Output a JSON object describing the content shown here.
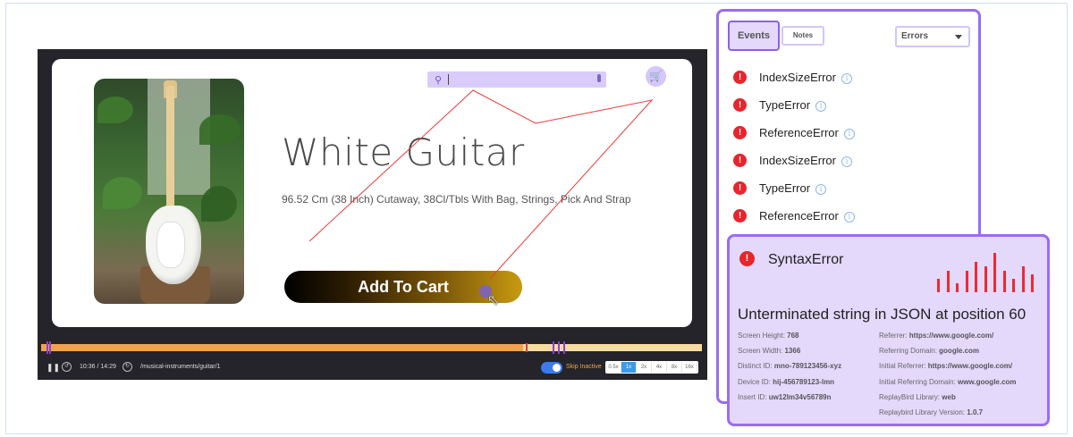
{
  "product": {
    "title": "White Guitar",
    "description": "96.52 Cm (38 Inch) Cutaway, 38Cl/Tbls With Bag, Strings, Pick And Strap",
    "add_to_cart": "Add To Cart",
    "photo_icon": "guitar-photo"
  },
  "header": {
    "search_icon": "search-icon",
    "mic_icon": "mic-icon",
    "cart_icon": "cart-icon"
  },
  "player": {
    "time": "10:36 / 14:29",
    "url": "/musical-instruments/guitar/1",
    "skip_inactive": "Skip Inactive",
    "speeds": [
      "0.5x",
      "1x",
      "2x",
      "4x",
      "8x",
      "16x"
    ],
    "active_speed": "1x",
    "progress": 0.73,
    "colors": {
      "played": "#f0a24a",
      "unplayed": "#f6dca0",
      "accent": "#3a9be8"
    }
  },
  "panel": {
    "tab_events": "Events",
    "tab_notes": "Notes",
    "filter": "Errors",
    "events": [
      {
        "label": "IndexSizeError"
      },
      {
        "label": "TypeError"
      },
      {
        "label": "ReferenceError"
      },
      {
        "label": "IndexSizeError"
      },
      {
        "label": "TypeError"
      },
      {
        "label": "ReferenceError"
      }
    ]
  },
  "detail": {
    "name": "SyntaxError",
    "message": "Unterminated string in JSON at position 60",
    "left": [
      {
        "key": "Screen Height:",
        "value": "768"
      },
      {
        "key": "Screen Width:",
        "value": "1366"
      },
      {
        "key": "Distinct ID:",
        "value": "mno-789123456-xyz"
      },
      {
        "key": "Device ID:",
        "value": "hij-456789123-lmn"
      },
      {
        "key": "Insert ID:",
        "value": "uw12lm34v56789n"
      }
    ],
    "right": [
      {
        "key": "Referrer:",
        "value": "https://www.google.com/"
      },
      {
        "key": "Referring Domain:",
        "value": "google.com"
      },
      {
        "key": "Initial Referrer:",
        "value": "https://www.google.com/"
      },
      {
        "key": "Initial Referring Domain:",
        "value": "www.google.com"
      },
      {
        "key": "ReplayBird Library:",
        "value": "web"
      },
      {
        "key": "Replaybird Library Version:",
        "value": "1.0.7"
      }
    ],
    "sparkline": [
      3,
      5,
      2,
      5,
      7,
      6,
      9,
      5,
      3,
      6,
      4
    ]
  }
}
